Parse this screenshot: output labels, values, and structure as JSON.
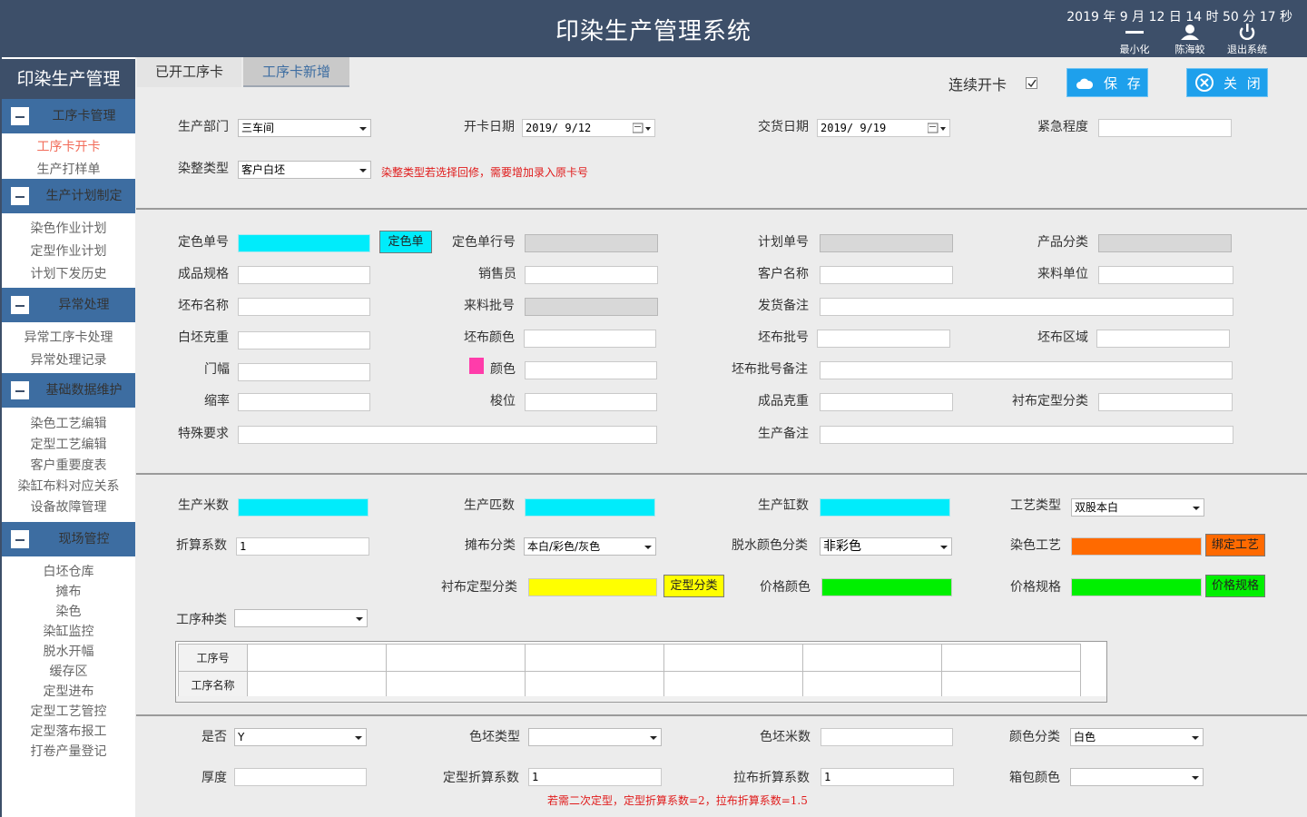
{
  "header": {
    "title": "印染生产管理系统",
    "datetime": "2019 年 9 月 12 日  14 时 50 分 17 秒",
    "minimize_label": "最小化",
    "user_label": "陈海蛟",
    "exit_label": "退出系统"
  },
  "sidebar": {
    "title": "印染生产管理",
    "sections": [
      {
        "label": "工序卡管理",
        "items": [
          "工序卡开卡",
          "生产打样单"
        ]
      },
      {
        "label": "生产计划制定",
        "items": [
          "染色作业计划",
          "定型作业计划",
          "计划下发历史"
        ]
      },
      {
        "label": "异常处理",
        "items": [
          "异常工序卡处理",
          "异常处理记录"
        ]
      },
      {
        "label": "基础数据维护",
        "items": [
          "染色工艺编辑",
          "定型工艺编辑",
          "客户重要度表",
          "染缸布料对应关系",
          "设备故障管理"
        ]
      },
      {
        "label": "现场管控",
        "items": [
          "白坯仓库",
          "摊布",
          "染色",
          "染缸监控",
          "脱水开幅",
          "缓存区",
          "定型进布",
          "定型工艺管控",
          "定型落布报工",
          "打卷产量登记"
        ]
      }
    ]
  },
  "tabs": {
    "open": "已开工序卡",
    "new": "工序卡新增"
  },
  "toolbar": {
    "continuous_label": "连续开卡",
    "continuous_checked": true,
    "save_label": "保 存",
    "close_label": "关 闭"
  },
  "form1": {
    "dept_label": "生产部门",
    "dept_value": "三车间",
    "open_date_label": "开卡日期",
    "open_date_value": "2019/ 9/12",
    "delivery_date_label": "交货日期",
    "delivery_date_value": "2019/ 9/19",
    "urgency_label": "紧急程度",
    "urgency_value": "",
    "finish_type_label": "染整类型",
    "finish_type_value": "客户白坯",
    "finish_type_note": "染整类型若选择回修，需要增加录入原卡号"
  },
  "form2": {
    "color_order_label": "定色单号",
    "color_order_btn": "定色单",
    "color_order_line_label": "定色单行号",
    "plan_no_label": "计划单号",
    "product_cat_label": "产品分类",
    "spec_label": "成品规格",
    "salesman_label": "销售员",
    "customer_label": "客户名称",
    "supplier_label": "来料单位",
    "greige_name_label": "坯布名称",
    "material_batch_label": "来料批号",
    "ship_note_label": "发货备注",
    "greige_weight_label": "白坯克重",
    "greige_color_label": "坯布颜色",
    "greige_batch_label": "坯布批号",
    "greige_area_label": "坯布区域",
    "width_label": "门幅",
    "color_label": "颜色",
    "greige_batch_note_label": "坯布批号备注",
    "shrink_label": "缩率",
    "shuttle_label": "梭位",
    "finished_weight_label": "成品克重",
    "lining_set_label": "衬布定型分类",
    "special_label": "特殊要求",
    "prod_note_label": "生产备注"
  },
  "form3": {
    "meters_label": "生产米数",
    "pieces_label": "生产匹数",
    "vats_label": "生产缸数",
    "process_type_label": "工艺类型",
    "process_type_value": "双股本白",
    "factor_label": "折算系数",
    "factor_value": "1",
    "spread_cat_label": "摊布分类",
    "spread_cat_value": "本白/彩色/灰色",
    "dewater_color_label": "脱水颜色分类",
    "dewater_color_value": "非彩色",
    "dye_process_label": "染色工艺",
    "bind_process_btn": "绑定工艺",
    "lining_set_label": "衬布定型分类",
    "set_cat_btn": "定型分类",
    "price_color_label": "价格颜色",
    "price_spec_label": "价格规格",
    "price_spec_btn": "价格规格",
    "proc_kind_label": "工序种类",
    "proc_kind_value": ""
  },
  "grid": {
    "row1_header": "工序号",
    "row2_header": "工序名称"
  },
  "form4": {
    "yesno_label": "是否",
    "yesno_value": "Y",
    "blank_type_label": "色坯类型",
    "blank_type_value": "",
    "blank_meters_label": "色坯米数",
    "color_cat_label": "颜色分类",
    "color_cat_value": "白色",
    "thickness_label": "厚度",
    "set_factor_label": "定型折算系数",
    "set_factor_value": "1",
    "stretch_factor_label": "拉布折算系数",
    "stretch_factor_value": "1",
    "box_color_label": "箱包颜色",
    "box_color_value": "",
    "note": "若需二次定型，定型折算系数=2，拉布折算系数=1.5"
  },
  "colors": {
    "header_bg": "#3d4f69",
    "section_bg": "#3d6da1",
    "accent_blue": "#1ea0ec",
    "swatch_pink": "#ff3caa"
  }
}
